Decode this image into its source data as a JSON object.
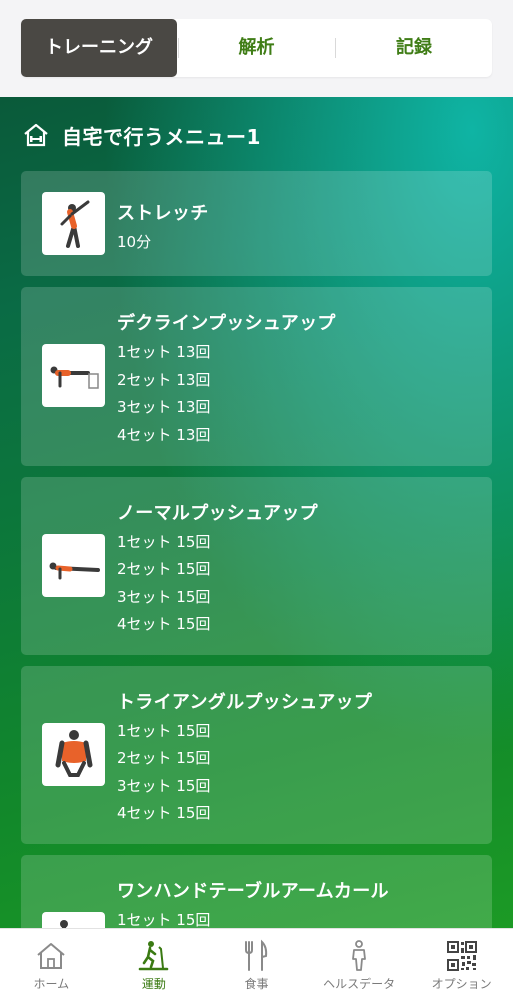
{
  "tabs": [
    {
      "label": "トレーニング",
      "active": true
    },
    {
      "label": "解析",
      "active": false
    },
    {
      "label": "記録",
      "active": false
    }
  ],
  "section": {
    "title": "自宅で行うメニュー1",
    "icon": "home-gym-icon"
  },
  "exercises": [
    {
      "name": "ストレッチ",
      "lines": [
        "10分"
      ],
      "icon": "stretch-figure-icon"
    },
    {
      "name": "デクラインプッシュアップ",
      "lines": [
        "1セット 13回",
        "2セット 13回",
        "3セット 13回",
        "4セット 13回"
      ],
      "icon": "decline-pushup-figure-icon"
    },
    {
      "name": "ノーマルプッシュアップ",
      "lines": [
        "1セット 15回",
        "2セット 15回",
        "3セット 15回",
        "4セット 15回"
      ],
      "icon": "pushup-figure-icon"
    },
    {
      "name": "トライアングルプッシュアップ",
      "lines": [
        "1セット 15回",
        "2セット 15回",
        "3セット 15回",
        "4セット 15回"
      ],
      "icon": "triangle-pushup-figure-icon"
    },
    {
      "name": "ワンハンドテーブルアームカール",
      "lines": [
        "1セット 15回"
      ],
      "icon": "arm-curl-figure-icon"
    }
  ],
  "bottom_nav": [
    {
      "label": "ホーム",
      "icon": "home-icon",
      "active": false
    },
    {
      "label": "運動",
      "icon": "treadmill-icon",
      "active": true
    },
    {
      "label": "食事",
      "icon": "fork-knife-icon",
      "active": false
    },
    {
      "label": "ヘルスデータ",
      "icon": "person-icon",
      "active": false
    },
    {
      "label": "オプション",
      "icon": "qr-code-icon",
      "active": false
    }
  ],
  "colors": {
    "accent": "#3f7d16",
    "active_tab_bg": "#4a4844",
    "figure_orange": "#e8622a"
  }
}
